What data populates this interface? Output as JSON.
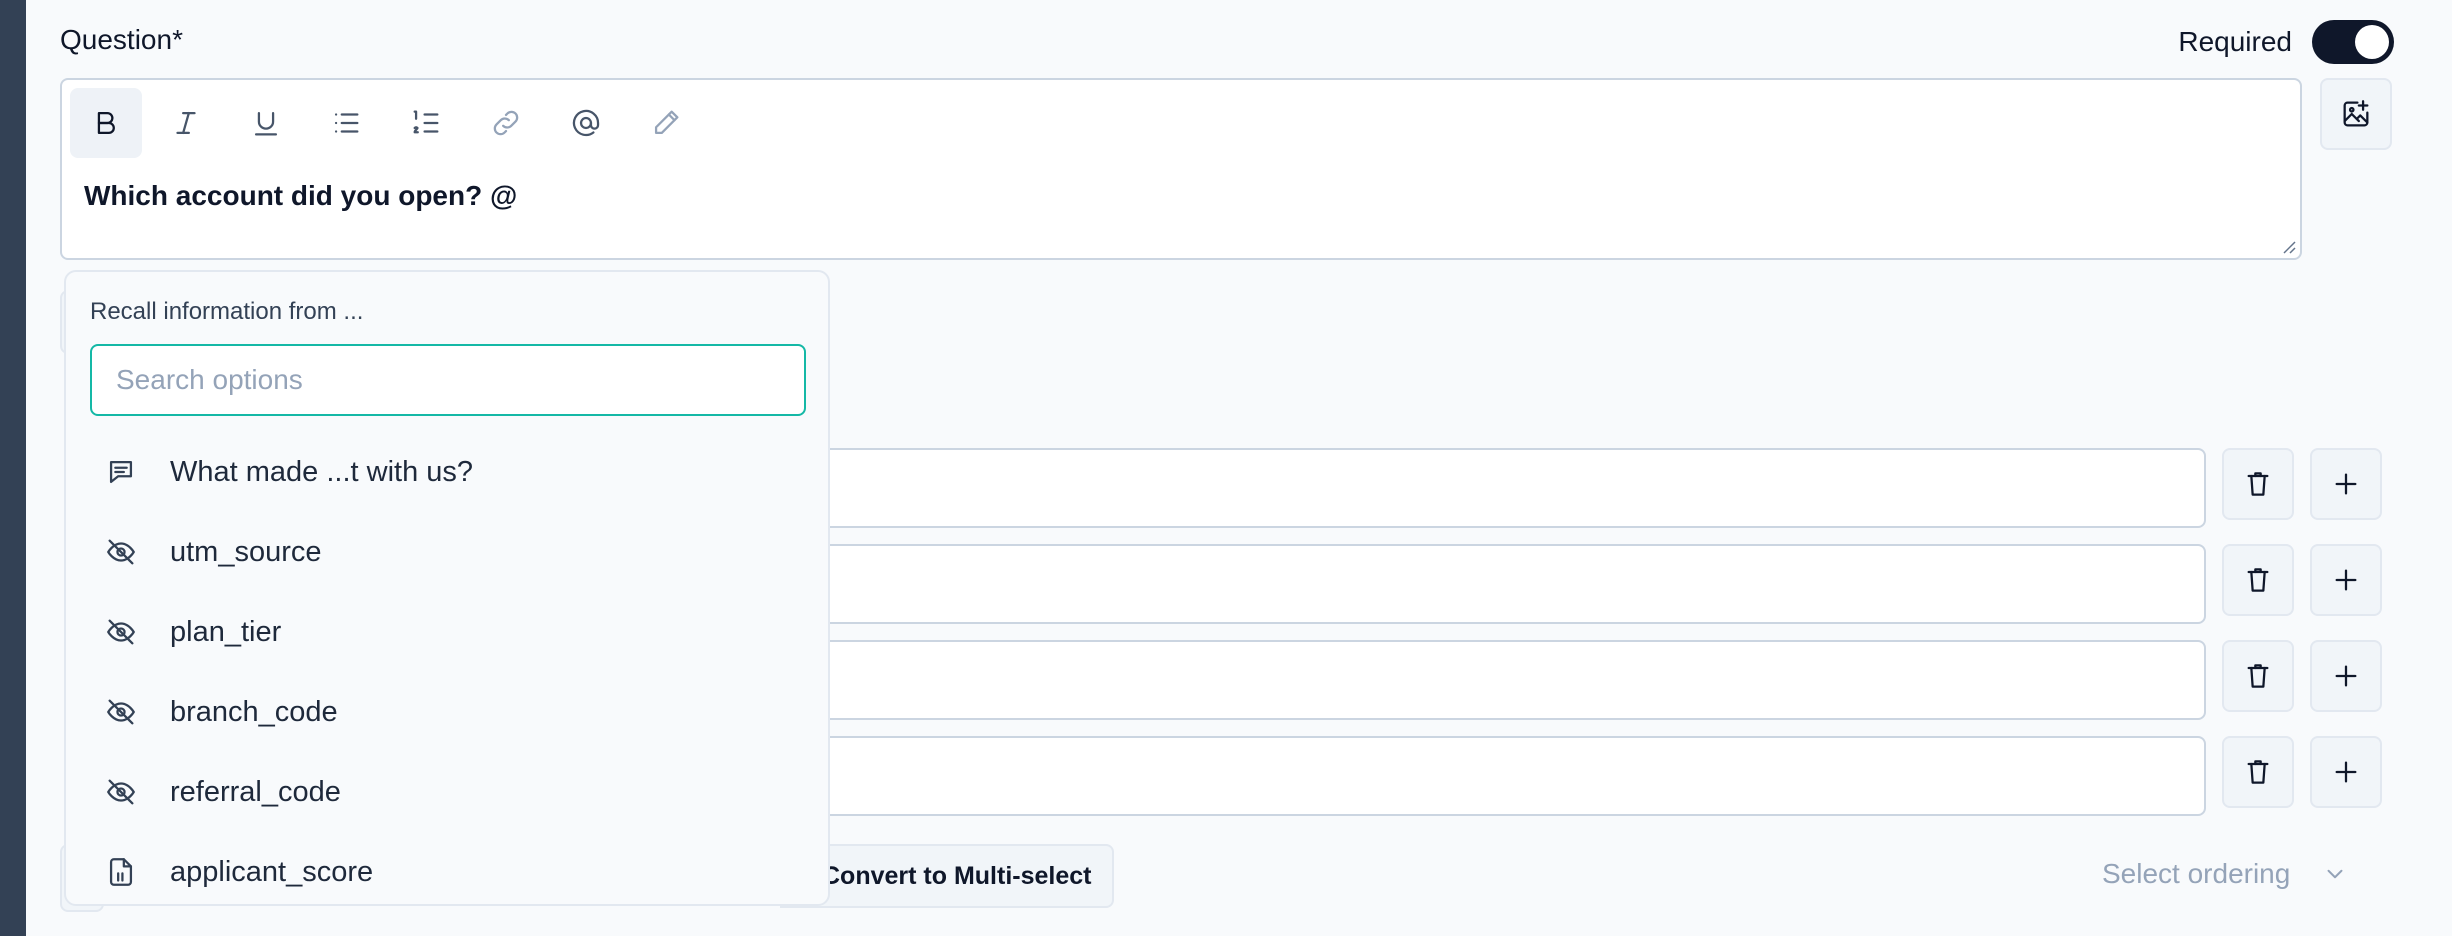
{
  "question": {
    "label": "Question*",
    "text": "Which account did you open? @"
  },
  "required": {
    "label": "Required",
    "enabled": true
  },
  "toolbar": {
    "tools": [
      "bold-icon",
      "italic-icon",
      "underline-icon",
      "bullet-list-icon",
      "numbered-list-icon",
      "link-icon",
      "mention-icon",
      "pencil-icon"
    ]
  },
  "recall": {
    "title": "Recall information from ...",
    "search_placeholder": "Search options",
    "items": [
      {
        "label": "What made ...t with us?",
        "icon": "message-icon"
      },
      {
        "label": "utm_source",
        "icon": "eye-off-icon"
      },
      {
        "label": "plan_tier",
        "icon": "eye-off-icon"
      },
      {
        "label": "branch_code",
        "icon": "eye-off-icon"
      },
      {
        "label": "referral_code",
        "icon": "eye-off-icon"
      },
      {
        "label": "applicant_score",
        "icon": "file-number-icon"
      }
    ]
  },
  "bottom": {
    "convert_label": "Convert to Multi-select",
    "ordering_placeholder": "Select ordering"
  },
  "colors": {
    "accent": "#14b8a6",
    "toggle_on": "#0f172a",
    "sidebar": "#334155"
  }
}
